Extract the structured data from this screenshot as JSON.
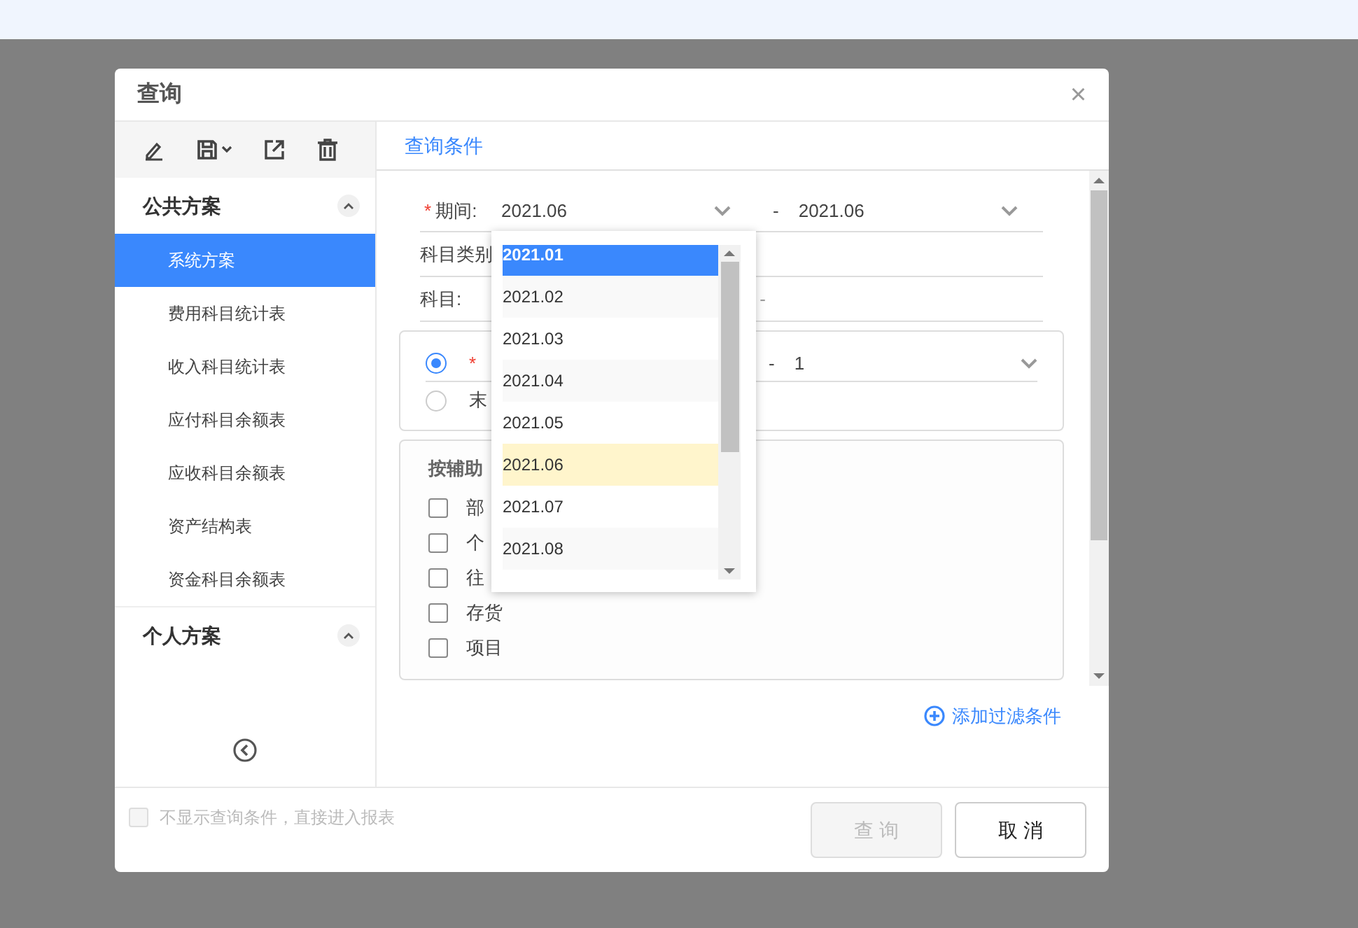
{
  "dialog": {
    "title": "查询",
    "close": "×"
  },
  "sidebar": {
    "groups": [
      {
        "name": "公共方案",
        "expanded": true,
        "items": [
          {
            "label": "系统方案",
            "selected": true
          },
          {
            "label": "费用科目统计表",
            "selected": false
          },
          {
            "label": "收入科目统计表",
            "selected": false
          },
          {
            "label": "应付科目余额表",
            "selected": false
          },
          {
            "label": "应收科目余额表",
            "selected": false
          },
          {
            "label": "资产结构表",
            "selected": false
          },
          {
            "label": "资金科目余额表",
            "selected": false
          }
        ]
      },
      {
        "name": "个人方案",
        "expanded": true
      }
    ]
  },
  "tabs": [
    {
      "label": "查询条件",
      "selected": true
    }
  ],
  "form": {
    "period": {
      "label": "期间:",
      "required_mark": "*",
      "from": "2021.06",
      "separator": "-",
      "to": "2021.06"
    },
    "rows": [
      {
        "label": "科目类别"
      },
      {
        "label": "科目:",
        "tail": "-"
      }
    ],
    "level_card": {
      "options": [
        {
          "required_mark": "*",
          "checked": true,
          "separator": "-",
          "to": "1"
        },
        {
          "label": "末",
          "checked": false
        }
      ]
    },
    "aux_card": {
      "title": "按辅助",
      "items": [
        {
          "label": "部",
          "checked": false
        },
        {
          "label": "个",
          "checked": false
        },
        {
          "label": "往",
          "checked": false
        },
        {
          "label": "存货",
          "checked": false
        },
        {
          "label": "项目",
          "checked": false
        }
      ]
    },
    "add_filter": "添加过滤条件"
  },
  "dropdown": {
    "options": [
      {
        "label": "2021.01",
        "selected": true,
        "highlighted": false
      },
      {
        "label": "2021.02",
        "selected": false,
        "highlighted": false
      },
      {
        "label": "2021.03",
        "selected": false,
        "highlighted": false
      },
      {
        "label": "2021.04",
        "selected": false,
        "highlighted": false
      },
      {
        "label": "2021.05",
        "selected": false,
        "highlighted": false
      },
      {
        "label": "2021.06",
        "selected": false,
        "highlighted": true
      },
      {
        "label": "2021.07",
        "selected": false,
        "highlighted": false
      },
      {
        "label": "2021.08",
        "selected": false,
        "highlighted": false
      }
    ]
  },
  "footer": {
    "skip_option": {
      "label": "不显示查询条件，直接进入报表",
      "checked": false,
      "disabled": true
    },
    "buttons": [
      {
        "label": "查 询",
        "disabled": true
      },
      {
        "label": "取 消",
        "disabled": false
      }
    ]
  }
}
